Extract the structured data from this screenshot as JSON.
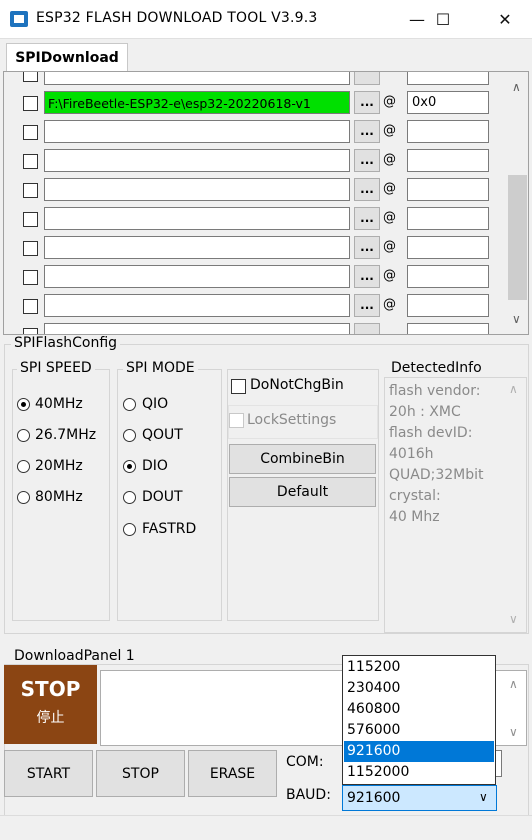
{
  "window": {
    "title": "ESP32 FLASH DOWNLOAD TOOL V3.9.3",
    "minimize": "—",
    "maximize": "☐",
    "close": "✕"
  },
  "tabs": [
    {
      "label": "SPIDownload",
      "active": true
    }
  ],
  "file_rows": [
    {
      "path": "F:\\FireBeetle-ESP32-e\\esp32-20220618-v1",
      "checked": false,
      "dots": "...",
      "at": "@",
      "address": "0x0",
      "highlight_color": "#00e000"
    },
    {
      "path": "",
      "checked": false,
      "dots": "...",
      "at": "@",
      "address": ""
    },
    {
      "path": "",
      "checked": false,
      "dots": "...",
      "at": "@",
      "address": ""
    },
    {
      "path": "",
      "checked": false,
      "dots": "...",
      "at": "@",
      "address": ""
    },
    {
      "path": "",
      "checked": false,
      "dots": "...",
      "at": "@",
      "address": ""
    },
    {
      "path": "",
      "checked": false,
      "dots": "...",
      "at": "@",
      "address": ""
    },
    {
      "path": "",
      "checked": false,
      "dots": "...",
      "at": "@",
      "address": ""
    },
    {
      "path": "",
      "checked": false,
      "dots": "...",
      "at": "@",
      "address": ""
    }
  ],
  "scroll_arrows": {
    "up": "∧",
    "down": "∨"
  },
  "spi_flash_config": {
    "title": "SPIFlashConfig",
    "speed": {
      "title": "SPI SPEED",
      "options": [
        "40MHz",
        "26.7MHz",
        "20MHz",
        "80MHz"
      ],
      "selected": "40MHz"
    },
    "mode": {
      "title": "SPI MODE",
      "options": [
        "QIO",
        "QOUT",
        "DIO",
        "DOUT",
        "FASTRD"
      ],
      "selected": "DIO"
    },
    "do_not_chg_bin": "DoNotChgBin",
    "lock_settings": "LockSettings",
    "combine_bin": "CombineBin",
    "default": "Default",
    "detected_info": {
      "title": "DetectedInfo",
      "lines": [
        "flash vendor:",
        "20h : XMC",
        "flash devID:",
        "4016h",
        "QUAD;32Mbit",
        "crystal:",
        "40 Mhz"
      ]
    }
  },
  "download_panel": {
    "title": "DownloadPanel 1",
    "stop_big": {
      "line1": "STOP",
      "line2": "停止",
      "color": "#8b4513"
    },
    "start": "START",
    "stop": "STOP",
    "erase": "ERASE",
    "com_label": "COM:",
    "baud_label": "BAUD:",
    "baud_value": "921600",
    "baud_dropdown_open": true,
    "baud_options": [
      "115200",
      "230400",
      "460800",
      "576000",
      "921600",
      "1152000"
    ],
    "baud_highlighted": "921600"
  }
}
